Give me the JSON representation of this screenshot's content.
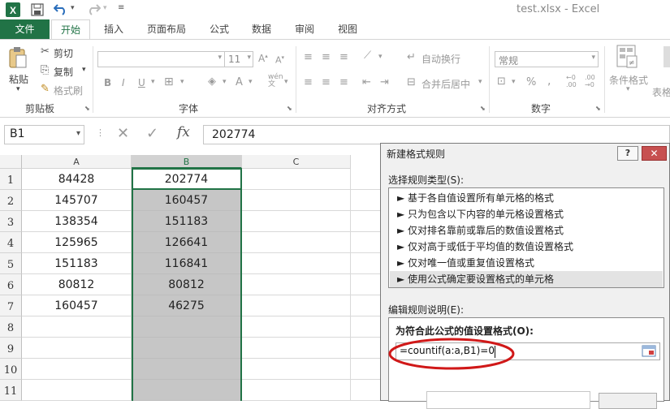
{
  "titlebar": {
    "title": "test.xlsx - Excel"
  },
  "ribbon_tabs": [
    "文件",
    "开始",
    "插入",
    "页面布局",
    "公式",
    "数据",
    "审阅",
    "视图"
  ],
  "ribbon": {
    "paste": "粘贴",
    "cut": "剪切",
    "copy": "复制",
    "format_painter": "格式刷",
    "clipboard_group": "剪贴板",
    "font_size": "11",
    "font_group": "字体",
    "wrap_text": "自动换行",
    "merge_center": "合并后居中",
    "alignment_group": "对齐方式",
    "number_format": "常规",
    "number_group": "数字",
    "conditional_format": "条件格式",
    "table_format_partial": "表格"
  },
  "formula_bar": {
    "name_box": "B1",
    "fx": "fx",
    "value": "202774"
  },
  "columns": [
    "A",
    "B",
    "C"
  ],
  "rows": [
    "1",
    "2",
    "3",
    "4",
    "5",
    "6",
    "7",
    "8",
    "9",
    "10",
    "11"
  ],
  "col_a": [
    "84428",
    "145707",
    "138354",
    "125965",
    "151183",
    "80812",
    "160457",
    "",
    "",
    "",
    ""
  ],
  "col_b": [
    "202774",
    "160457",
    "151183",
    "126641",
    "116841",
    "80812",
    "46275",
    "",
    "",
    "",
    ""
  ],
  "dialog": {
    "title": "新建格式规则",
    "help": "?",
    "select_label": "选择规则类型(S):",
    "rules": [
      "► 基于各自值设置所有单元格的格式",
      "► 只为包含以下内容的单元格设置格式",
      "► 仅对排名靠前或靠后的数值设置格式",
      "► 仅对高于或低于平均值的数值设置格式",
      "► 仅对唯一值或重复值设置格式",
      "► 使用公式确定要设置格式的单元格"
    ],
    "edit_label": "编辑规则说明(E):",
    "formula_label": "为符合此公式的值设置格式(O):",
    "formula_value": "=countif(a:a,B1)=0"
  },
  "colors": {
    "excel_green": "#217346",
    "highlight_red": "#d01818",
    "selection_gray": "#c6c6c6"
  }
}
